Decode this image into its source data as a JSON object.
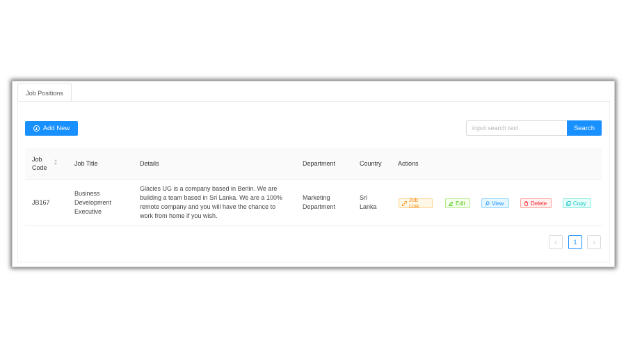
{
  "tabs": [
    {
      "label": "Job Positions"
    }
  ],
  "toolbar": {
    "add_label": "Add New",
    "search_placeholder": "input search text",
    "search_button": "Search"
  },
  "table": {
    "columns": {
      "job_code": "Job Code",
      "job_title": "Job Title",
      "details": "Details",
      "department": "Department",
      "country": "Country",
      "actions": "Actions"
    },
    "rows": [
      {
        "job_code": "JB167",
        "job_title": "Business Development Executive",
        "details": "Glacies UG is a company based in Berlin. We are building a team based in Sri Lanka. We are a 100% remote company and you will have the chance to work from home if you wish.",
        "department": "Marketing Department",
        "country": "Sri Lanka",
        "actions": {
          "job_link": "Job Link",
          "edit": "Edit",
          "view": "View",
          "delete": "Delete",
          "copy": "Copy"
        }
      }
    ]
  },
  "pagination": {
    "prev": "‹",
    "current_page": "1",
    "next": "›"
  },
  "colors": {
    "primary": "#1890ff",
    "job_link": "#fa8c16",
    "edit": "#52c41a",
    "view": "#1890ff",
    "delete": "#f5222d",
    "copy": "#13c2c2"
  },
  "icons": {
    "add": "plus-circle-icon",
    "sort": "sort-icon",
    "job_link": "link-icon",
    "edit": "edit-icon",
    "view": "search-icon",
    "delete": "delete-icon",
    "copy": "copy-icon"
  }
}
